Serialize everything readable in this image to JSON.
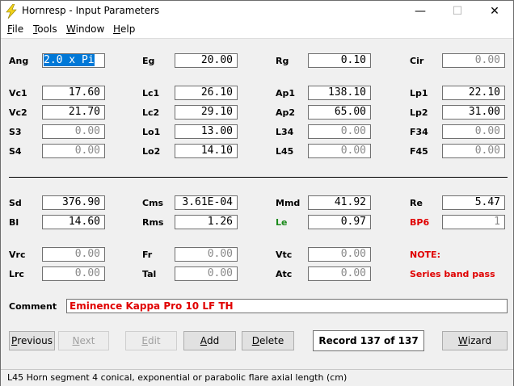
{
  "window": {
    "title": "Hornresp - Input Parameters",
    "minimize": "—",
    "maximize": "☐",
    "close": "✕"
  },
  "menu": [
    {
      "first": "F",
      "rest": "ile"
    },
    {
      "first": "T",
      "rest": "ools"
    },
    {
      "first": "W",
      "rest": "indow"
    },
    {
      "first": "H",
      "rest": "elp"
    }
  ],
  "params": {
    "ang": {
      "label": "Ang",
      "value": "2.0 x Pi"
    },
    "eg": {
      "label": "Eg",
      "value": "20.00"
    },
    "rg": {
      "label": "Rg",
      "value": "0.10"
    },
    "cir": {
      "label": "Cir",
      "value": "0.00"
    },
    "vc1": {
      "label": "Vc1",
      "value": "17.60"
    },
    "lc1": {
      "label": "Lc1",
      "value": "26.10"
    },
    "ap1": {
      "label": "Ap1",
      "value": "138.10"
    },
    "lp1": {
      "label": "Lp1",
      "value": "22.10"
    },
    "vc2": {
      "label": "Vc2",
      "value": "21.70"
    },
    "lc2": {
      "label": "Lc2",
      "value": "29.10"
    },
    "ap2": {
      "label": "Ap2",
      "value": "65.00"
    },
    "lp2": {
      "label": "Lp2",
      "value": "31.00"
    },
    "s3": {
      "label": "S3",
      "value": "0.00"
    },
    "lo1": {
      "label": "Lo1",
      "value": "13.00"
    },
    "l34": {
      "label": "L34",
      "value": "0.00"
    },
    "f34": {
      "label": "F34",
      "value": "0.00"
    },
    "s4": {
      "label": "S4",
      "value": "0.00"
    },
    "lo2": {
      "label": "Lo2",
      "value": "14.10"
    },
    "l45": {
      "label": "L45",
      "value": "0.00"
    },
    "f45": {
      "label": "F45",
      "value": "0.00"
    },
    "sd": {
      "label": "Sd",
      "value": "376.90"
    },
    "cms": {
      "label": "Cms",
      "value": "3.61E-04"
    },
    "mmd": {
      "label": "Mmd",
      "value": "41.92"
    },
    "re": {
      "label": "Re",
      "value": "5.47"
    },
    "bl": {
      "label": "Bl",
      "value": "14.60"
    },
    "rms": {
      "label": "Rms",
      "value": "1.26"
    },
    "le": {
      "label": "Le",
      "value": "0.97"
    },
    "bp6": {
      "label": "BP6",
      "value": "1"
    },
    "vrc": {
      "label": "Vrc",
      "value": "0.00"
    },
    "fr": {
      "label": "Fr",
      "value": "0.00"
    },
    "vtc": {
      "label": "Vtc",
      "value": "0.00"
    },
    "lrc": {
      "label": "Lrc",
      "value": "0.00"
    },
    "tal": {
      "label": "Tal",
      "value": "0.00"
    },
    "atc": {
      "label": "Atc",
      "value": "0.00"
    }
  },
  "note": {
    "title": "NOTE:",
    "text": "Series band pass"
  },
  "comment": {
    "label": "Comment",
    "value": "Eminence Kappa Pro 10 LF TH"
  },
  "buttons": {
    "previous": {
      "first": "P",
      "rest": "revious"
    },
    "next": {
      "first": "N",
      "rest": "ext"
    },
    "edit": {
      "first": "E",
      "rest": "dit"
    },
    "add": {
      "first": "A",
      "rest": "dd"
    },
    "delete": {
      "first": "D",
      "rest": "elete"
    },
    "wizard": {
      "first": "W",
      "rest": "izard"
    }
  },
  "record": "Record 137 of 137",
  "status": "L45   Horn segment 4 conical, exponential or parabolic flare axial length  (cm)",
  "colors": {
    "label_red": "#e00000",
    "label_green": "#1a8a1a",
    "selection": "#0078d7"
  }
}
